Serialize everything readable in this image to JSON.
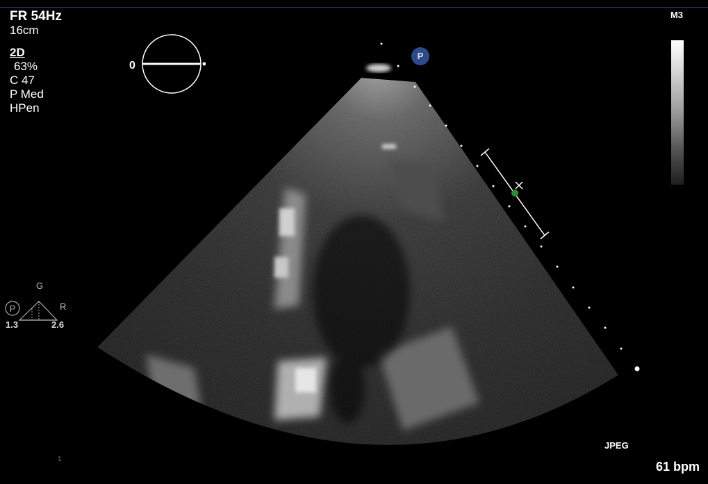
{
  "header": {
    "frame_rate": "FR 54Hz",
    "depth": "16cm",
    "mode": "2D",
    "gain": "63%",
    "compression": "C 47",
    "power": "P Med",
    "harmonics": "HPen"
  },
  "probe": {
    "label": "M3",
    "orientation_marker": "P",
    "angle_value": "0"
  },
  "gain_range_widget": {
    "top_label": "G",
    "right_label": "R",
    "p_label": "P",
    "left_value": "1.3",
    "right_value": "2.6"
  },
  "footer": {
    "format": "JPEG",
    "heart_rate": "61 bpm",
    "frame_marker": "1"
  },
  "colors": {
    "background": "#000000",
    "text": "#ffffff",
    "probe_marker": "#2f4a8a",
    "focus_marker": "#2e8b3e"
  }
}
